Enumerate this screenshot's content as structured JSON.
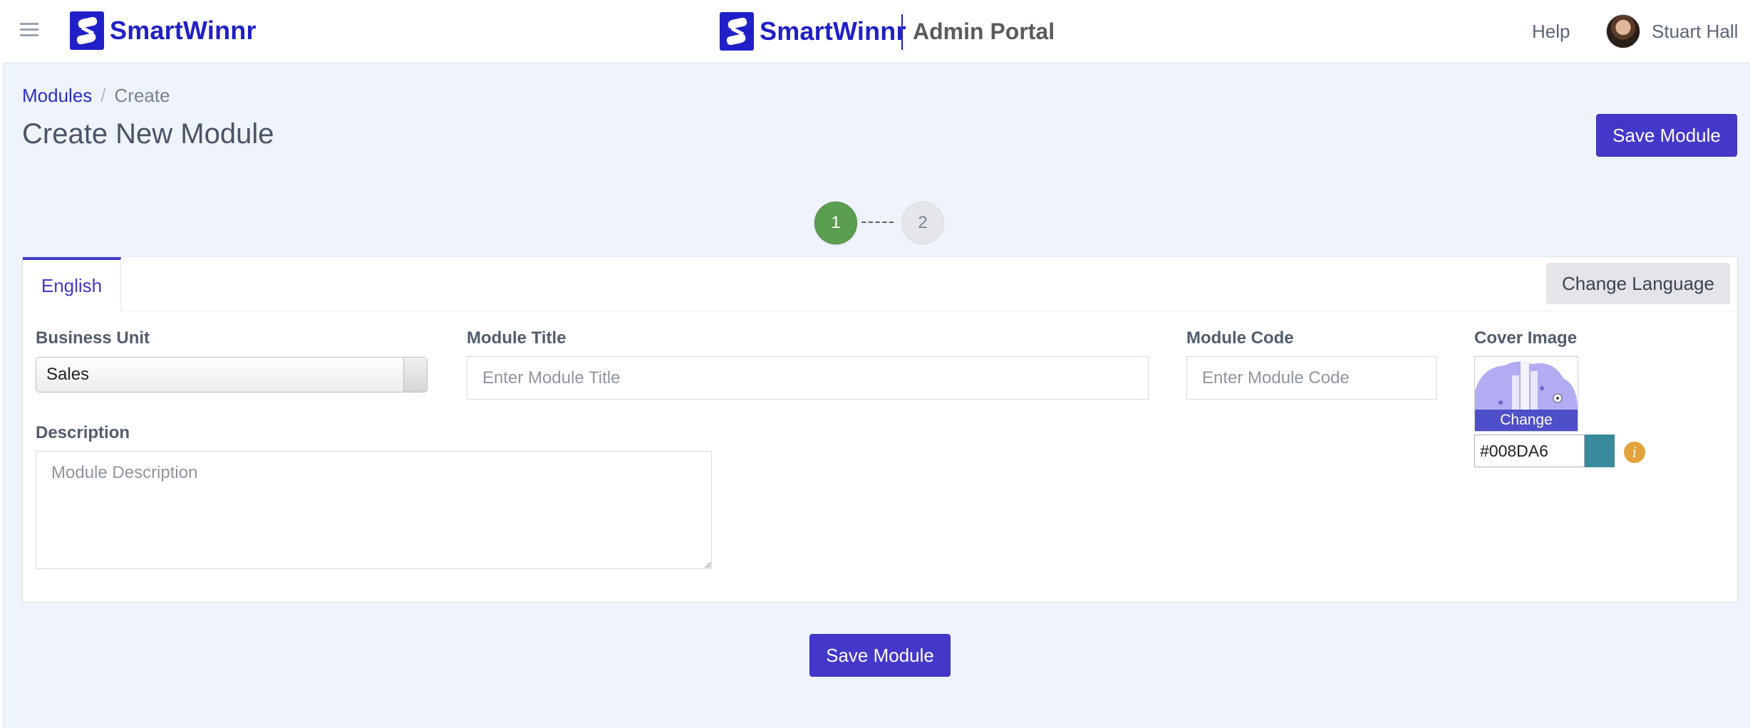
{
  "header": {
    "brand": "SmartWinnr",
    "center_brand": "SmartWinnr",
    "portal_title": "Admin Portal",
    "help_label": "Help",
    "user_name": "Stuart Hall"
  },
  "breadcrumb": {
    "parent": "Modules",
    "current": "Create"
  },
  "page": {
    "title": "Create New Module",
    "save_label": "Save Module",
    "save_bottom_label": "Save Module"
  },
  "stepper": {
    "steps": [
      "1",
      "2"
    ],
    "connector": "-----",
    "active_step": 1
  },
  "tabs": {
    "language_tab": "English",
    "change_language_label": "Change Language"
  },
  "form": {
    "business_unit_label": "Business Unit",
    "business_unit_value": "Sales",
    "module_title_label": "Module Title",
    "module_title_placeholder": "Enter Module Title",
    "module_code_label": "Module Code",
    "module_code_placeholder": "Enter Module Code",
    "cover_image_label": "Cover Image",
    "cover_change_label": "Change",
    "color_value": "#008DA6",
    "description_label": "Description",
    "description_placeholder": "Module Description",
    "info_icon_glyph": "i"
  },
  "colors": {
    "brand": "#2020C8",
    "primary_button": "#4338CA",
    "step_active": "#5C9E4F",
    "swatch": "#388A9C",
    "info": "#E2A23C"
  }
}
